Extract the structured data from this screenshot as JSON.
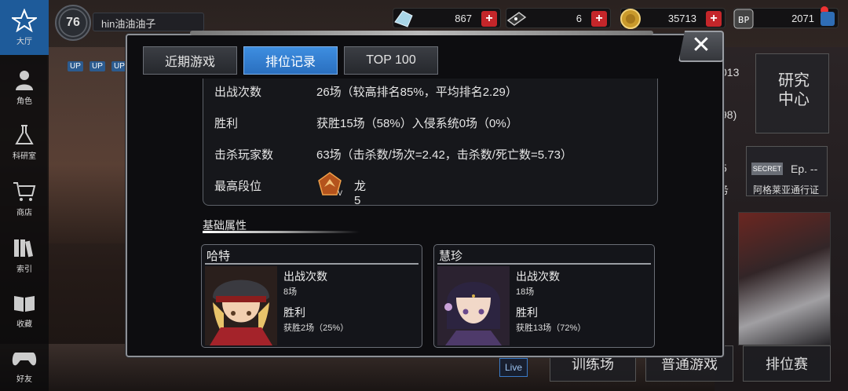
{
  "sidebar": {
    "items": [
      {
        "label": "大厅",
        "icon": "star-hall-icon"
      },
      {
        "label": "角色",
        "icon": "character-icon"
      },
      {
        "label": "科研室",
        "icon": "flask-icon"
      },
      {
        "label": "商店",
        "icon": "cart-icon"
      },
      {
        "label": "索引",
        "icon": "books-icon"
      },
      {
        "label": "收藏",
        "icon": "open-book-icon"
      },
      {
        "label": "好友",
        "icon": "gamepad-icon"
      }
    ]
  },
  "profile": {
    "level": "76",
    "name": "hin油油油子"
  },
  "resources": {
    "crystal": "867",
    "ticket": "6",
    "coin": "35713",
    "bp": "2071"
  },
  "background": {
    "research_center": "研究\n中心",
    "right_num_1": "013",
    "right_num_2": "98)",
    "secret_label": "SECRET",
    "episode": "Ep. --",
    "pass_label": "阿格莱亚通行证",
    "partial_1": "5",
    "partial_2": "务",
    "live_label": "Live",
    "buttons": [
      "训练场",
      "普通游戏",
      "排位赛"
    ]
  },
  "modal": {
    "tabs": [
      {
        "label": "近期游戏",
        "active": false
      },
      {
        "label": "排位记录",
        "active": true
      },
      {
        "label": "TOP 100",
        "active": false
      }
    ],
    "close_label": "✕",
    "stats": {
      "matches_label": "出战次数",
      "matches_value": "26场（较高排名85%，平均排名2.29）",
      "wins_label": "胜利",
      "wins_value": "获胜15场（58%）入侵系统0场（0%）",
      "kills_label": "击杀玩家数",
      "kills_value": "63场（击杀数/场次=2.42，击杀数/死亡数=5.73）",
      "rank_label": "最高段位",
      "rank_value": "龙5",
      "rank_icon": "dragon-rank-badge-icon"
    },
    "section_title": "基础属性",
    "characters": [
      {
        "name": "哈特",
        "matches_label": "出战次数",
        "matches_value": "8场",
        "wins_label": "胜利",
        "wins_value": "获胜2场（25%）"
      },
      {
        "name": "慧珍",
        "matches_label": "出战次数",
        "matches_value": "18场",
        "wins_label": "胜利",
        "wins_value": "获胜13场（72%）"
      }
    ]
  }
}
